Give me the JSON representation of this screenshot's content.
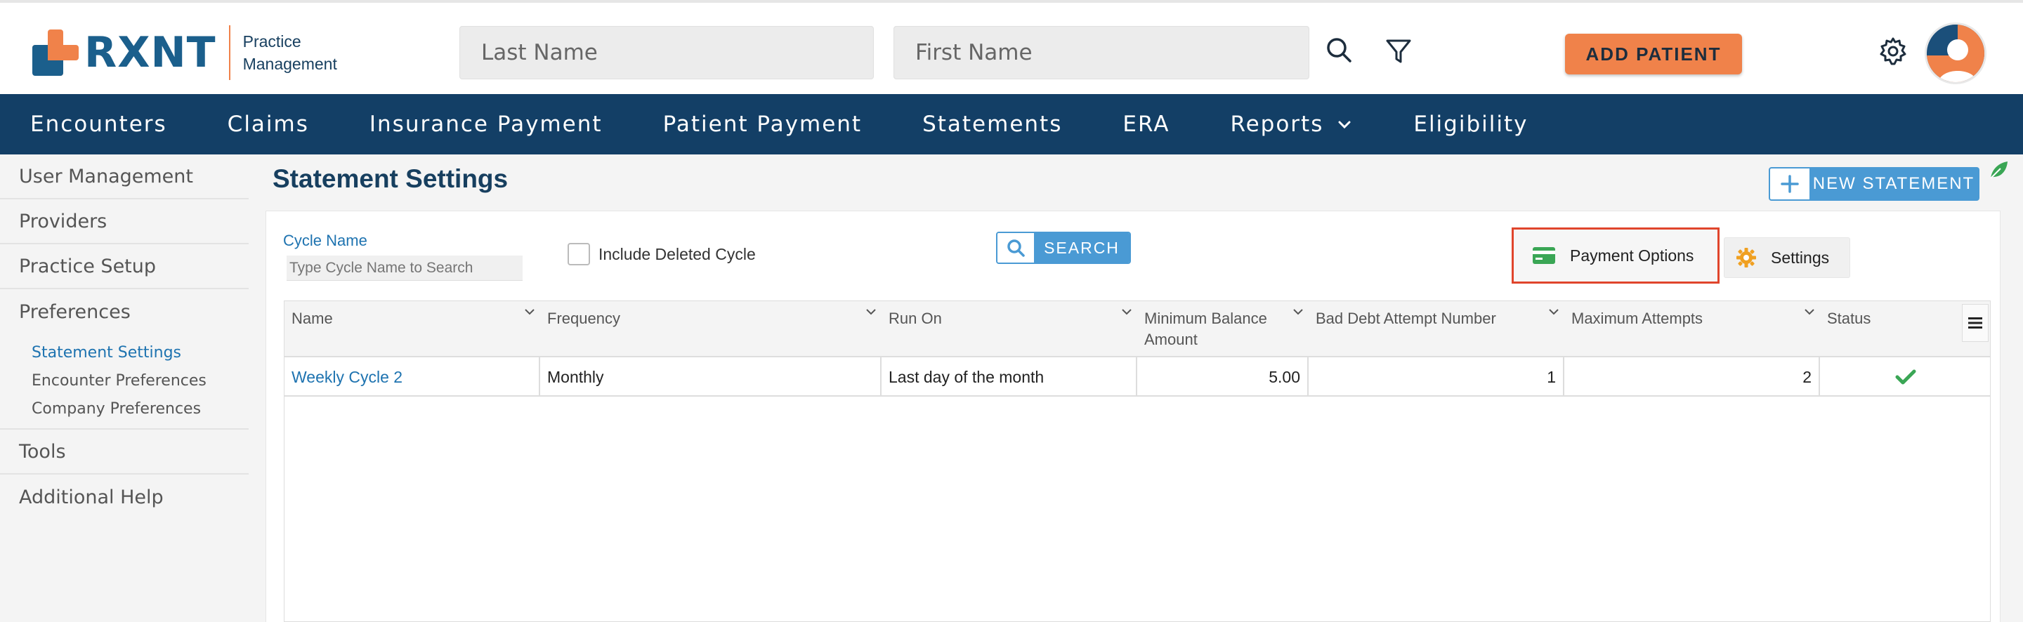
{
  "header": {
    "logo_text": "RXNT",
    "logo_sub_line1": "Practice",
    "logo_sub_line2": "Management",
    "last_name_placeholder": "Last Name",
    "first_name_placeholder": "First Name",
    "add_patient_label": "ADD PATIENT"
  },
  "nav": {
    "items": [
      "Encounters",
      "Claims",
      "Insurance Payment",
      "Patient Payment",
      "Statements",
      "ERA",
      "Reports",
      "Eligibility"
    ]
  },
  "sidebar": {
    "user_management": "User Management",
    "providers": "Providers",
    "practice_setup": "Practice Setup",
    "preferences": "Preferences",
    "sub_items": [
      "Statement Settings",
      "Encounter Preferences",
      "Company Preferences"
    ],
    "tools": "Tools",
    "additional_help": "Additional Help"
  },
  "main": {
    "title": "Statement Settings",
    "new_statement_label": "NEW STATEMENT",
    "cycle_name_label": "Cycle Name",
    "cycle_name_placeholder": "Type Cycle Name to Search",
    "include_deleted_label": "Include Deleted Cycle",
    "search_label": "SEARCH",
    "payment_options_label": "Payment Options",
    "settings_label": "Settings"
  },
  "table": {
    "columns": [
      "Name",
      "Frequency",
      "Run On",
      "Minimum Balance Amount",
      "Bad Debt Attempt Number",
      "Maximum Attempts",
      "Status"
    ],
    "rows": [
      {
        "name": "Weekly Cycle 2",
        "frequency": "Monthly",
        "run_on": "Last day of the month",
        "min_balance": "5.00",
        "bad_debt_attempt": "1",
        "max_attempts": "2",
        "status": "active"
      }
    ]
  },
  "colors": {
    "brand_blue": "#1b5f8c",
    "brand_orange": "#f0824a",
    "nav_bg": "#133f66",
    "accent_blue": "#4a9ad4",
    "highlight_red": "#e0452c",
    "status_green": "#3aa655"
  }
}
